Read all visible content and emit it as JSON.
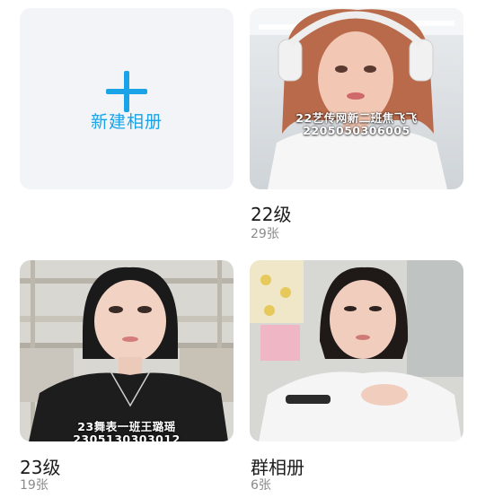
{
  "new_album": {
    "label": "新建相册",
    "icon": "plus-icon",
    "accent_color": "#1aa3e6"
  },
  "albums": [
    {
      "title": "22级",
      "count": "29张",
      "cover_text_line1": "22艺传网新二班焦飞飞",
      "cover_text_line2": "2205050306005"
    },
    {
      "title": "23级",
      "count": "19张",
      "cover_text_line1": "23舞表一班王璐瑶",
      "cover_text_line2": "2305130303012"
    },
    {
      "title": "群相册",
      "count": "6张"
    }
  ]
}
